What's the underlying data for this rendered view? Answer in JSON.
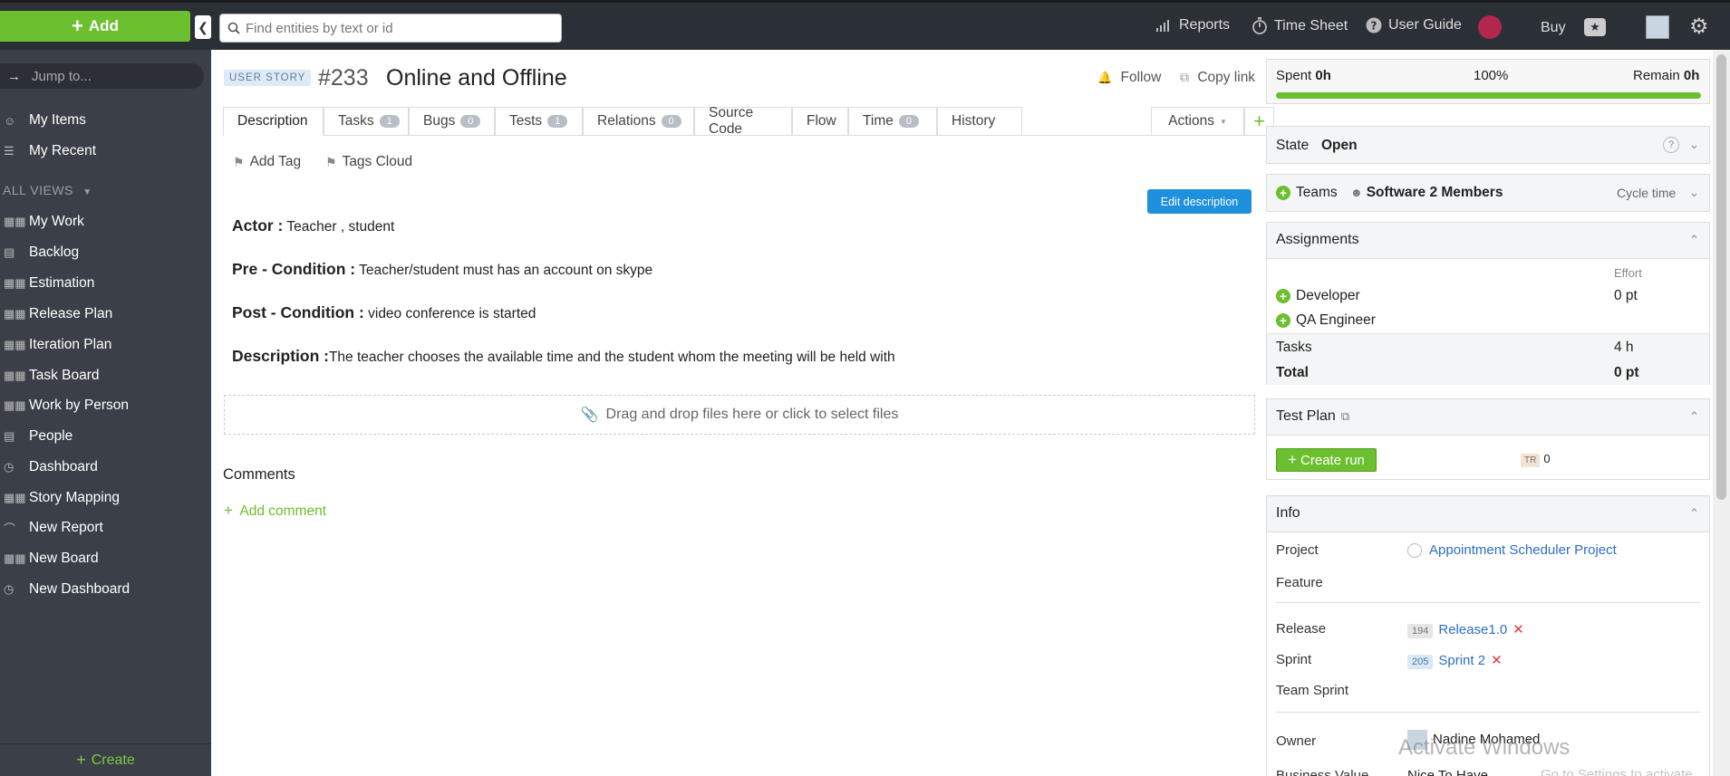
{
  "topbar": {
    "add_label": "Add",
    "search_placeholder": "Find entities by text or id",
    "reports": "Reports",
    "timesheet": "Time Sheet",
    "user_guide": "User Guide",
    "buy": "Buy"
  },
  "sidebar": {
    "jump_placeholder": "Jump to...",
    "top_items": [
      {
        "label": "My Items",
        "icon": "user-icon"
      },
      {
        "label": "My Recent",
        "icon": "recent-icon"
      }
    ],
    "views_header": "ALL VIEWS",
    "views": [
      {
        "label": "My Work",
        "icon": "board-icon"
      },
      {
        "label": "Backlog",
        "icon": "list-icon"
      },
      {
        "label": "Estimation",
        "icon": "board-icon"
      },
      {
        "label": "Release Plan",
        "icon": "board-icon"
      },
      {
        "label": "Iteration Plan",
        "icon": "board-icon"
      },
      {
        "label": "Task Board",
        "icon": "board-icon"
      },
      {
        "label": "Work by Person",
        "icon": "board-icon"
      },
      {
        "label": "People",
        "icon": "list-icon"
      },
      {
        "label": "Dashboard",
        "icon": "dashboard-icon"
      },
      {
        "label": "Story Mapping",
        "icon": "board-lock-icon"
      },
      {
        "label": "New Report",
        "icon": "report-lock-icon"
      },
      {
        "label": "New Board",
        "icon": "board-lock-icon"
      },
      {
        "label": "New Dashboard",
        "icon": "dashboard-lock-icon"
      }
    ],
    "create_label": "Create"
  },
  "entity": {
    "type_badge": "USER STORY",
    "id": "#233",
    "title": "Online and Offline",
    "follow": "Follow",
    "copy_link": "Copy link"
  },
  "tabs": [
    {
      "label": "Description"
    },
    {
      "label": "Tasks",
      "count": "1"
    },
    {
      "label": "Bugs",
      "count": "0"
    },
    {
      "label": "Tests",
      "count": "1"
    },
    {
      "label": "Relations",
      "count": "0"
    },
    {
      "label": "Source Code"
    },
    {
      "label": "Flow"
    },
    {
      "label": "Time",
      "count": "0"
    },
    {
      "label": "History"
    }
  ],
  "actions_label": "Actions",
  "tags": {
    "add_tag": "Add Tag",
    "tags_cloud": "Tags Cloud"
  },
  "edit_description": "Edit description",
  "description": [
    {
      "key": "Actor :",
      "value": " Teacher , student"
    },
    {
      "key": "Pre - Condition :",
      "value": " Teacher/student must has an account on skype"
    },
    {
      "key": "Post - Condition :",
      "value": " video conference is started"
    },
    {
      "key": "Description :",
      "value": "The teacher chooses the available time and the student whom the meeting will be held with"
    }
  ],
  "dropzone": "Drag and drop files here or click to select files",
  "comments": {
    "title": "Comments",
    "add": "Add comment"
  },
  "right": {
    "progress": {
      "spent_label": "Spent",
      "spent": "0h",
      "percent": "100%",
      "remain_label": "Remain",
      "remain": "0h",
      "fraction": 1.0
    },
    "state": {
      "label": "State",
      "value": "Open"
    },
    "teams": {
      "label": "Teams",
      "value": "Software 2 Members",
      "cycle": "Cycle time"
    },
    "assignments": {
      "title": "Assignments",
      "effort_header": "Effort",
      "roles": [
        {
          "label": "Developer",
          "effort": "0 pt"
        },
        {
          "label": "QA Engineer",
          "effort": ""
        }
      ],
      "tasks_label": "Tasks",
      "tasks_value": "4 h",
      "total_label": "Total",
      "total_value": "0 pt"
    },
    "test_plan": {
      "title": "Test Plan",
      "create_run": "Create run",
      "tr_badge": "TR",
      "tr_count": "0"
    },
    "info": {
      "title": "Info",
      "project_label": "Project",
      "project_value": "Appointment Scheduler Project",
      "feature_label": "Feature",
      "release_label": "Release",
      "release_id": "194",
      "release_value": "Release1.0",
      "sprint_label": "Sprint",
      "sprint_id": "205",
      "sprint_value": "Sprint 2",
      "team_sprint_label": "Team Sprint",
      "owner_label": "Owner",
      "owner_value": "Nadine Mohamed",
      "business_value_label": "Business Value",
      "business_value": "Nice To Have"
    }
  },
  "watermark": {
    "title": "Activate Windows",
    "sub": "Go to Settings to activate Windows."
  },
  "colors": {
    "accent_green": "#6cbf2f",
    "topbar": "#2b2f36",
    "sidebar": "#3b3f47",
    "link_blue": "#2c6fc5",
    "button_blue": "#1e90dc"
  }
}
